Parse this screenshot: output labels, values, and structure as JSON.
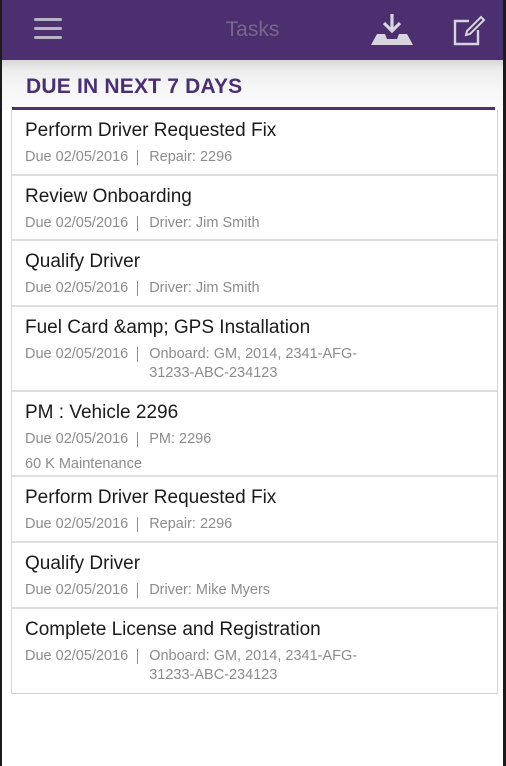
{
  "header": {
    "title": "Tasks",
    "menu_icon": "hamburger-menu-icon",
    "download_icon": "download-tray-icon",
    "edit_icon": "compose-edit-icon"
  },
  "section": {
    "label": "DUE IN NEXT 7 DAYS"
  },
  "tasks": [
    {
      "name": "Perform Driver Requested Fix",
      "due": "Due 02/05/2016",
      "detail": "Repair: 2296"
    },
    {
      "name": "Review Onboarding",
      "due": "Due 02/05/2016",
      "detail": "Driver: Jim Smith"
    },
    {
      "name": "Qualify Driver",
      "due": "Due 02/05/2016",
      "detail": "Driver: Jim Smith"
    },
    {
      "name": "Fuel Card &amp; GPS Installation",
      "due": "Due 02/05/2016",
      "detail": "Onboard: GM, 2014, 2341-AFG-31233-ABC-234123"
    },
    {
      "name": "PM : Vehicle 2296",
      "due": "Due 02/05/2016",
      "detail": "PM: 2296",
      "extra": "60 K Maintenance"
    },
    {
      "name": "Perform Driver Requested Fix",
      "due": "Due 02/05/2016",
      "detail": "Repair: 2296"
    },
    {
      "name": "Qualify Driver",
      "due": "Due 02/05/2016",
      "detail": "Driver: Mike Myers"
    },
    {
      "name": "Complete License and Registration",
      "due": "Due 02/05/2016",
      "detail": "Onboard: GM, 2014, 2341-AFG-31233-ABC-234123"
    }
  ],
  "colors": {
    "brand": "#4b2f6f",
    "header_text": "#4a2f73",
    "muted": "#8c8c8c"
  }
}
